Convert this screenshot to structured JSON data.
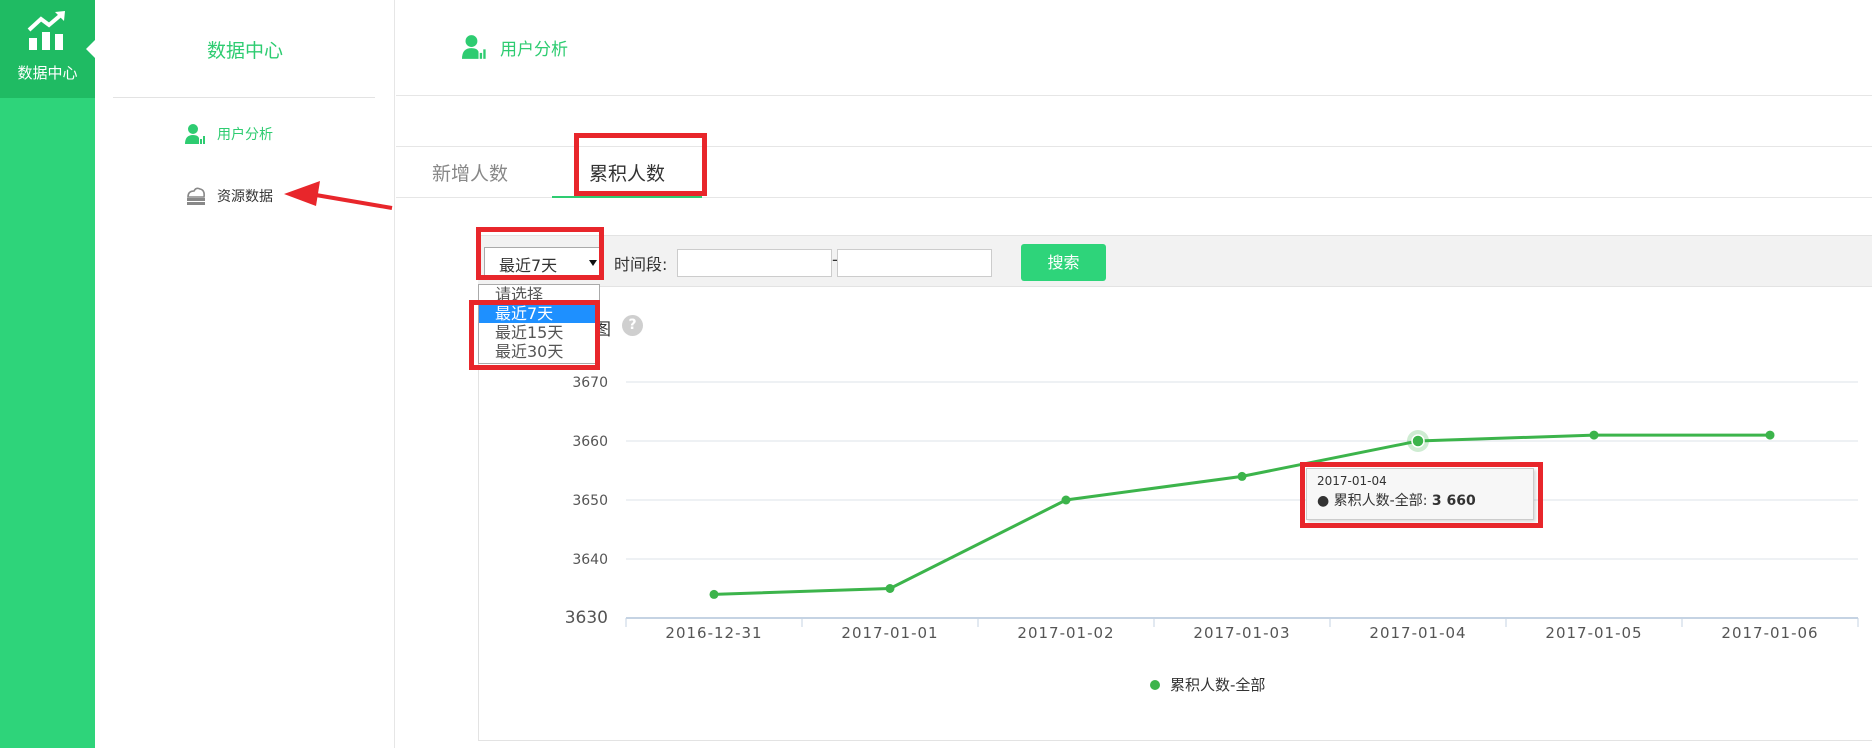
{
  "rail": {
    "label": "数据中心"
  },
  "sidebar": {
    "title": "数据中心",
    "items": [
      {
        "label": "用户分析",
        "icon": "user-chart-icon",
        "active": true
      },
      {
        "label": "资源数据",
        "icon": "cloud-storage-icon",
        "active": false
      }
    ]
  },
  "header": {
    "label": "用户分析",
    "icon": "user-chart-icon"
  },
  "tabs": [
    {
      "label": "新增人数",
      "active": false
    },
    {
      "label": "累积人数",
      "active": true
    }
  ],
  "filter": {
    "select_value": "最近7天",
    "period_label": "时间段:",
    "date_from": "",
    "date_to": "",
    "dash": "-",
    "search_label": "搜索",
    "options": [
      "请选择",
      "最近7天",
      "最近15天",
      "最近30天"
    ],
    "selected_option": "最近7天"
  },
  "chart_title_fragment": "图",
  "help_symbol": "?",
  "chart_data": {
    "type": "line",
    "categories": [
      "2016-12-31",
      "2017-01-01",
      "2017-01-02",
      "2017-01-03",
      "2017-01-04",
      "2017-01-05",
      "2017-01-06"
    ],
    "series": [
      {
        "name": "累积人数-全部",
        "values": [
          3634,
          3635,
          3650,
          3654,
          3660,
          3661,
          3661
        ]
      }
    ],
    "y_ticks": [
      3630,
      3640,
      3650,
      3660,
      3670
    ],
    "ylim": [
      3630,
      3670
    ],
    "grid": true,
    "legend_position": "bottom-center",
    "line_color": "#3cb44b"
  },
  "tooltip": {
    "date": "2017-01-04",
    "series_label": "累积人数-全部:",
    "value": "3 660"
  },
  "colors": {
    "brand_green": "#2ed47a",
    "accent_text": "#2ecc71",
    "highlight_red": "#e8262b",
    "series_green": "#3cb44b"
  }
}
